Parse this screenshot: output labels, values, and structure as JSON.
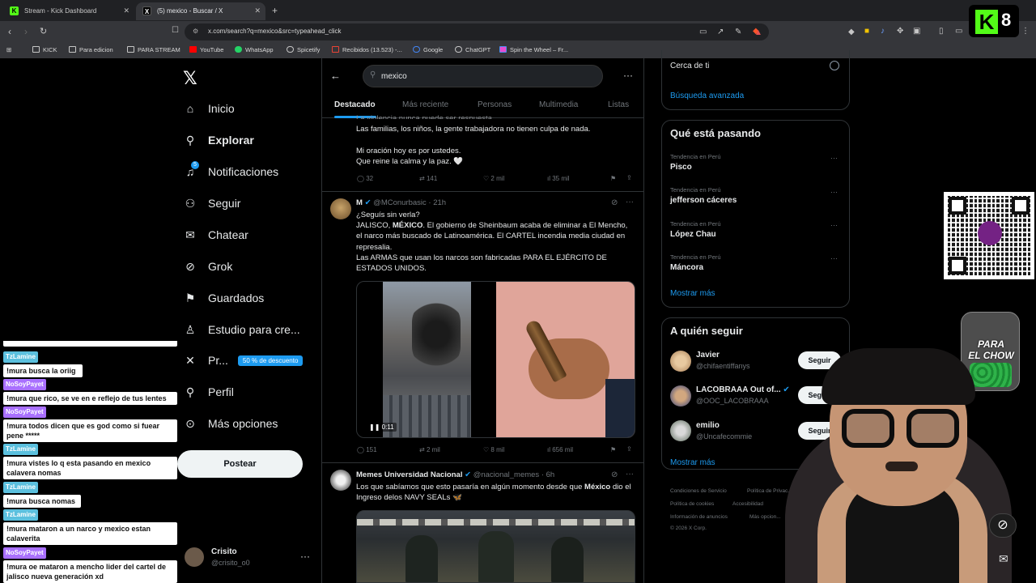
{
  "browser": {
    "tabs": [
      {
        "title": "Stream - Kick Dashboard"
      },
      {
        "title": "(5) mexico - Buscar / X"
      }
    ],
    "url": "x.com/search?q=mexico&src=typeahead_click",
    "bookmarks": [
      "KICK",
      "Para edicion",
      "PARA STREAM",
      "YouTube",
      "WhatsApp",
      "Spicetify",
      "Recibidos (13.523) -...",
      "Google",
      "ChatGPT",
      "Spin the Wheel – Fr..."
    ]
  },
  "overlay": {
    "kick_count": "8",
    "jar_label": "PARA\nEL CHOW"
  },
  "x_nav": {
    "items": [
      "Inicio",
      "Explorar",
      "Notificaciones",
      "Seguir",
      "Chatear",
      "Grok",
      "Guardados",
      "Estudio para cre...",
      "Pr...",
      "Perfil",
      "Más opciones"
    ],
    "notif_badge": "5",
    "promo": "50 % de descuento",
    "post_button": "Postear",
    "account_name": "Crisito",
    "account_handle": "@crisito_o0"
  },
  "chat": [
    {
      "user": "TzLamine",
      "color": "#5bc0de",
      "msg": "!mura busca la oriig"
    },
    {
      "user": "NoSoyPayet",
      "color": "#a970ff",
      "msg": "!mura que rico, se ve en e reflejo de tus lentes"
    },
    {
      "user": "NoSoyPayet",
      "color": "#a970ff",
      "msg": "!mura todos dicen que es god como si fuear pene *****"
    },
    {
      "user": "TzLamine",
      "color": "#5bc0de",
      "msg": "!mura vistes lo q esta pasando en mexico calavera nomas"
    },
    {
      "user": "TzLamine",
      "color": "#5bc0de",
      "msg": "!mura busca nomas"
    },
    {
      "user": "TzLamine",
      "color": "#5bc0de",
      "msg": "!mura mataron a un narco y mexico estan calaverita"
    },
    {
      "user": "NoSoyPayet",
      "color": "#a970ff",
      "msg": "!mura oe mataron a mencho lider del cartel de jalisco nueva generación xd"
    }
  ],
  "search": {
    "query": "mexico",
    "tabs": [
      "Destacado",
      "Más reciente",
      "Personas",
      "Multimedia",
      "Listas"
    ]
  },
  "feed": {
    "tweet0": {
      "lines": [
        "La violencia nunca puede ser respuesta.",
        "Las familias, los niños, la gente trabajadora no tienen culpa de nada.",
        "",
        "Mi oración hoy es por ustedes.",
        "Que reine la calma y la paz. 🤍"
      ],
      "replies": "32",
      "reposts": "141",
      "likes": "2 mil",
      "views": "35 mil"
    },
    "tweet1": {
      "name": "M",
      "handle": "@MConurbasic",
      "time": "21h",
      "text_1": "¿Seguís sin verla?",
      "text_2a": "JALISCO, ",
      "text_2b": "MÉXICO",
      "text_2c": ". El gobierno de Sheinbaum acaba de eliminar a El Mencho, el narco más buscado de Latinoamérica. El CARTEL incendia media ciudad en represalia.",
      "text_3": "Las ARMAS que usan los narcos son fabricadas PARA EL EJÉRCITO DE ESTADOS UNIDOS.",
      "video_time": "0:11",
      "replies": "151",
      "reposts": "2 mil",
      "likes": "8 mil",
      "views": "656 mil"
    },
    "tweet2": {
      "name": "Memes Universidad Nacional",
      "handle": "@nacional_memes",
      "time": "6h",
      "text_a": "Los que sabíamos que esto pasaría en algún momento desde que ",
      "text_b": "México",
      "text_c": " dio el Ingreso delos NAVY SEALs 🦋"
    }
  },
  "right": {
    "near_you": "Cerca de ti",
    "advanced": "Búsqueda avanzada",
    "trends_title": "Qué está pasando",
    "trends": [
      {
        "context": "Tendencia en Perú",
        "name": "Pisco"
      },
      {
        "context": "Tendencia en Perú",
        "name": "jefferson cáceres"
      },
      {
        "context": "Tendencia en Perú",
        "name": "López Chau"
      },
      {
        "context": "Tendencia en Perú",
        "name": "Máncora"
      }
    ],
    "show_more": "Mostrar más",
    "who_title": "A quién seguir",
    "who": [
      {
        "name": "Javier",
        "handle": "@chifaentiffanys",
        "btn": "Seguir"
      },
      {
        "name": "LACOBRAAA Out of...",
        "handle": "@OOC_LACOBRAAA",
        "btn": "Seguir"
      },
      {
        "name": "emilio",
        "handle": "@Uncafecommie",
        "btn": "Seguir"
      }
    ],
    "show_more_2": "Mostrar más",
    "footer": [
      "Condiciones de Servicio",
      "Política de Privac...",
      "Política de cookies",
      "Accesibilidad",
      "Información de anuncios",
      "Más opcion...",
      "© 2026 X Corp."
    ]
  },
  "colors": {
    "accent": "#1d9bf0",
    "kick_green": "#53fc18"
  }
}
